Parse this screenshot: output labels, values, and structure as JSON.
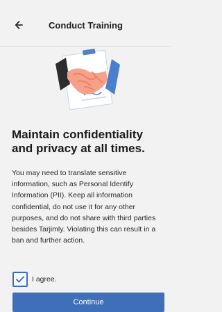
{
  "header": {
    "title": "Conduct Training",
    "back_icon": "back-arrow-icon"
  },
  "illustration": {
    "icon": "handshake-icon"
  },
  "content": {
    "headline": "Maintain confidentiality and privacy at all times.",
    "paragraph": "You may need to translate sensitive information, such as Personal Identify Information (PII). Keep all information confidential, do not use it for any other purposes, and do not share with third parties besides Tarjimly. Violating this can result in a ban and further action."
  },
  "agreement": {
    "label": "I agree.",
    "checked": true
  },
  "actions": {
    "continue_label": "Continue"
  },
  "colors": {
    "background": "#f2f2f2",
    "primary": "#3f6fb9",
    "text": "#1f1f1f"
  }
}
